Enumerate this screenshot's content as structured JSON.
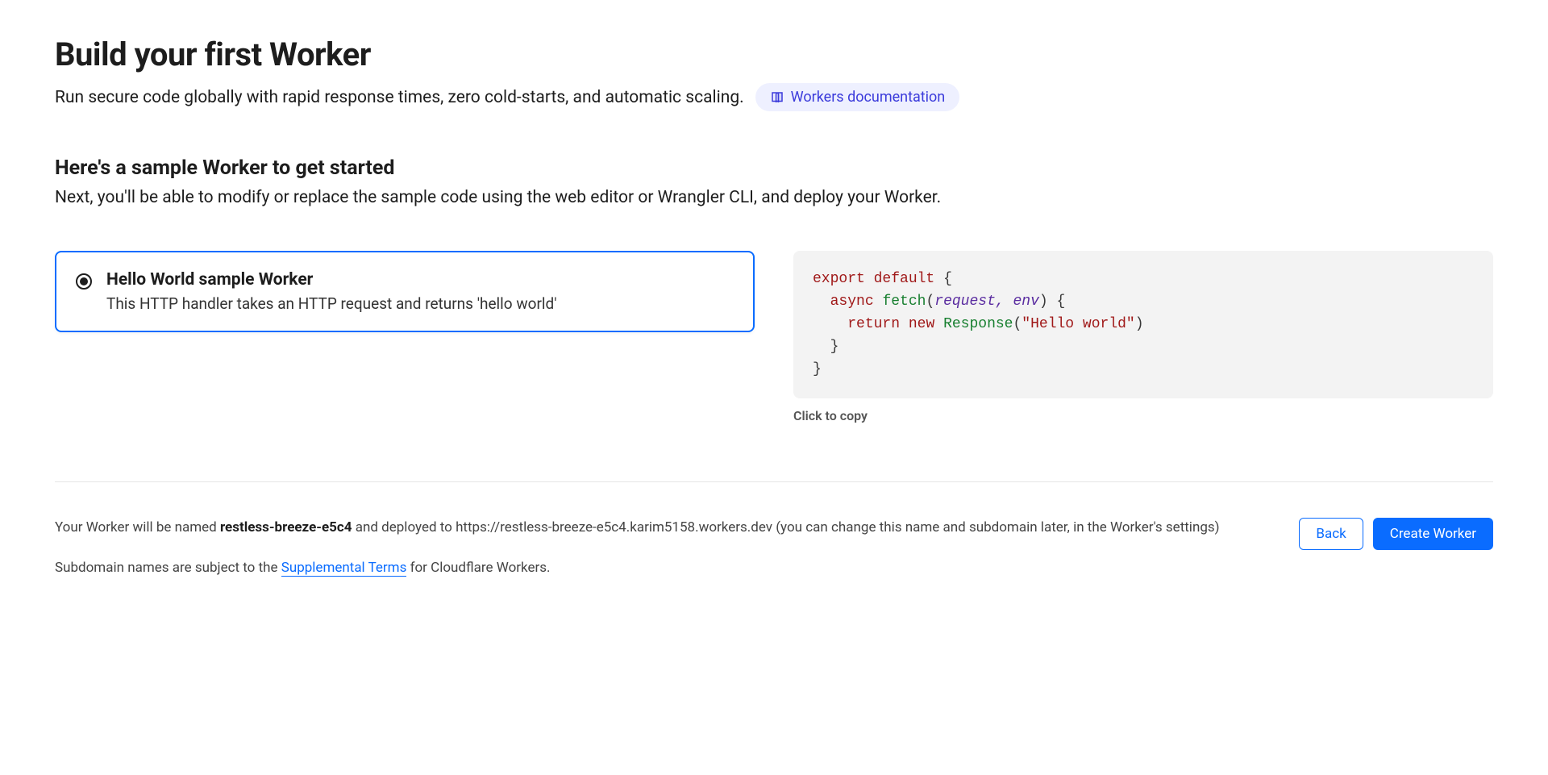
{
  "header": {
    "title": "Build your first Worker",
    "subtitle": "Run secure code globally with rapid response times, zero cold-starts, and automatic scaling.",
    "doc_link_label": "Workers documentation"
  },
  "section": {
    "title": "Here's a sample Worker to get started",
    "desc": "Next, you'll be able to modify or replace the sample code using the web editor or Wrangler CLI, and deploy your Worker."
  },
  "option": {
    "title": "Hello World sample Worker",
    "desc": "This HTTP handler takes an HTTP request and returns 'hello world'",
    "selected": true
  },
  "code": {
    "tokens": {
      "kw_export": "export",
      "kw_default": "default",
      "brace_open": "{",
      "kw_async": "async",
      "fn_fetch": "fetch",
      "paren_open": "(",
      "param_request": "request,",
      "param_env": "env",
      "paren_close": ")",
      "brace_open2": "{",
      "kw_return": "return",
      "kw_new": "new",
      "cls_response": "Response",
      "paren_open2": "(",
      "str_hello": "\"Hello world\"",
      "paren_close2": ")",
      "brace_close": "}",
      "brace_close2": "}"
    },
    "copy_hint": "Click to copy"
  },
  "footer": {
    "deploy_prefix": "Your Worker will be named ",
    "worker_name": "restless-breeze-e5c4",
    "deploy_mid": " and deployed to https://restless-breeze-e5c4.karim5158.workers.dev (you can change this name and subdomain later, in the Worker's settings)",
    "subdomain_prefix": "Subdomain names are subject to the ",
    "terms_link": "Supplemental Terms",
    "subdomain_suffix": " for Cloudflare Workers.",
    "back_label": "Back",
    "create_label": "Create Worker"
  }
}
